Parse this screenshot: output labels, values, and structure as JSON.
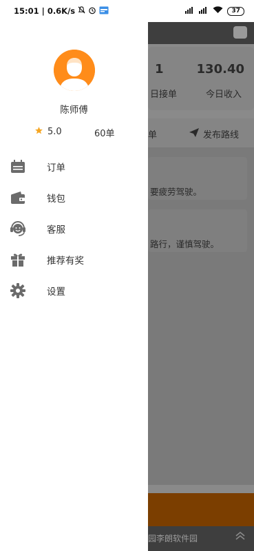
{
  "status_bar": {
    "time": "15:01",
    "speed": "0.6K/s",
    "battery": "37"
  },
  "background": {
    "stat1_value": "1",
    "stat1_label": "日接单",
    "stat2_value": "130.40",
    "stat2_label": "今日收入",
    "tab1_label": "单",
    "tab2_label": "发布路线",
    "notice1": "要疲劳驾驶。",
    "notice2": "路行，谨慎驾驶。",
    "footer_text": "园李朗软件园"
  },
  "drawer": {
    "driver_name": "陈师傅",
    "rating": "5.0",
    "orders": "60单",
    "menu": [
      {
        "label": "订单",
        "icon": "calendar-icon"
      },
      {
        "label": "钱包",
        "icon": "wallet-icon"
      },
      {
        "label": "客服",
        "icon": "headset-icon"
      },
      {
        "label": "推荐有奖",
        "icon": "gift-icon"
      },
      {
        "label": "设置",
        "icon": "gear-icon"
      }
    ]
  },
  "colors": {
    "accent": "#ff8c1a",
    "star": "#f5a623",
    "icon_gray": "#6b6b6b"
  }
}
